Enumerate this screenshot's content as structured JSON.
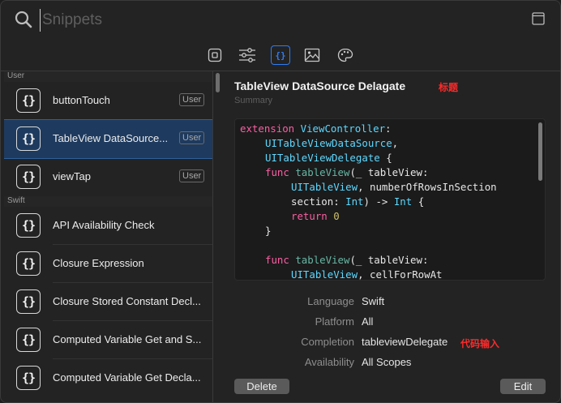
{
  "search": {
    "placeholder": "Snippets"
  },
  "toolbar": {
    "tabs": [
      {
        "name": "snippets"
      },
      {
        "name": "modifiers"
      },
      {
        "name": "code-snippets"
      },
      {
        "name": "media"
      },
      {
        "name": "colors"
      }
    ],
    "active_tab": "code-snippets"
  },
  "sidebar": {
    "section_user": "User",
    "section_swift": "Swift",
    "icon_glyph": "{}",
    "user_items": [
      {
        "label": "buttonTouch",
        "badge": "User"
      },
      {
        "label": "TableView DataSource...",
        "badge": "User",
        "selected": true
      },
      {
        "label": "viewTap",
        "badge": "User"
      }
    ],
    "swift_items": [
      {
        "label": "API Availability Check"
      },
      {
        "label": "Closure Expression"
      },
      {
        "label": "Closure Stored Constant Decl..."
      },
      {
        "label": "Computed Variable Get and S..."
      },
      {
        "label": "Computed Variable Get Decla..."
      }
    ]
  },
  "detail": {
    "title": "TableView DataSource Delagate",
    "title_annotation": "标题",
    "summary_placeholder": "Summary",
    "code": {
      "line1a": "extension ",
      "line1b": "ViewController",
      "line1c": ":",
      "line2": "UITableViewDataSource",
      "line2b": ",",
      "line3": "UITableViewDelegate",
      "line3b": " {",
      "line4a": "func ",
      "line4b": "tableView",
      "line4c": "(_ tableView:",
      "line5a": "UITableView",
      "line5b": ", numberOfRowsInSection",
      "line6a": "section: ",
      "line6b": "Int",
      "line6c": ") -> ",
      "line6d": "Int",
      "line6e": " {",
      "line7a": "return ",
      "line7b": "0",
      "line8": "}",
      "line10a": "func ",
      "line10b": "tableView",
      "line10c": "(_ tableView:",
      "line11a": "UITableView",
      "line11b": ", cellForRowAt"
    },
    "properties": {
      "language_label": "Language",
      "language_value": "Swift",
      "platform_label": "Platform",
      "platform_value": "All",
      "completion_label": "Completion",
      "completion_value": "tableviewDelegate",
      "completion_annotation": "代码输入",
      "availability_label": "Availability",
      "availability_value": "All Scopes"
    },
    "delete_label": "Delete",
    "edit_label": "Edit"
  }
}
